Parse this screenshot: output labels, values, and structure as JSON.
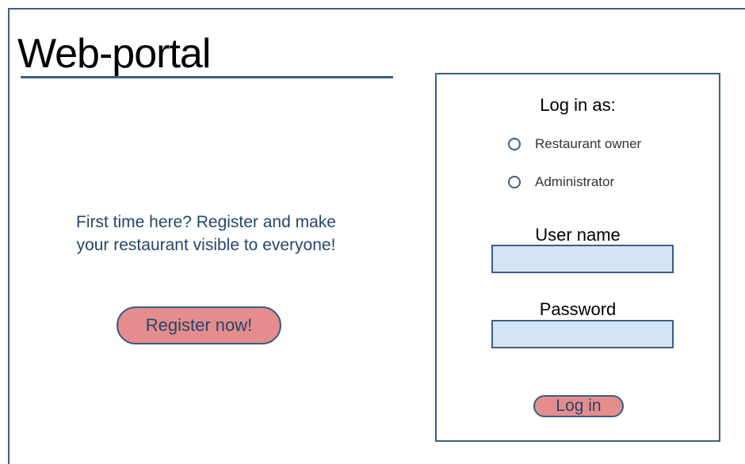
{
  "header": {
    "title": "Web-portal"
  },
  "promo": {
    "line1": "First time here? Register and make",
    "line2": "your restaurant visible to everyone!",
    "register_label": "Register now!"
  },
  "login": {
    "heading": "Log in as:",
    "roles": [
      {
        "label": "Restaurant owner",
        "selected": false
      },
      {
        "label": "Administrator",
        "selected": false
      }
    ],
    "username_label": "User name",
    "username_value": "",
    "password_label": "Password",
    "password_value": "",
    "login_label": "Log in"
  },
  "colors": {
    "accent_border": "#3a5f86",
    "button_fill": "#e58c8c",
    "input_fill": "#d3e3f5",
    "promo_text": "#23476b"
  }
}
